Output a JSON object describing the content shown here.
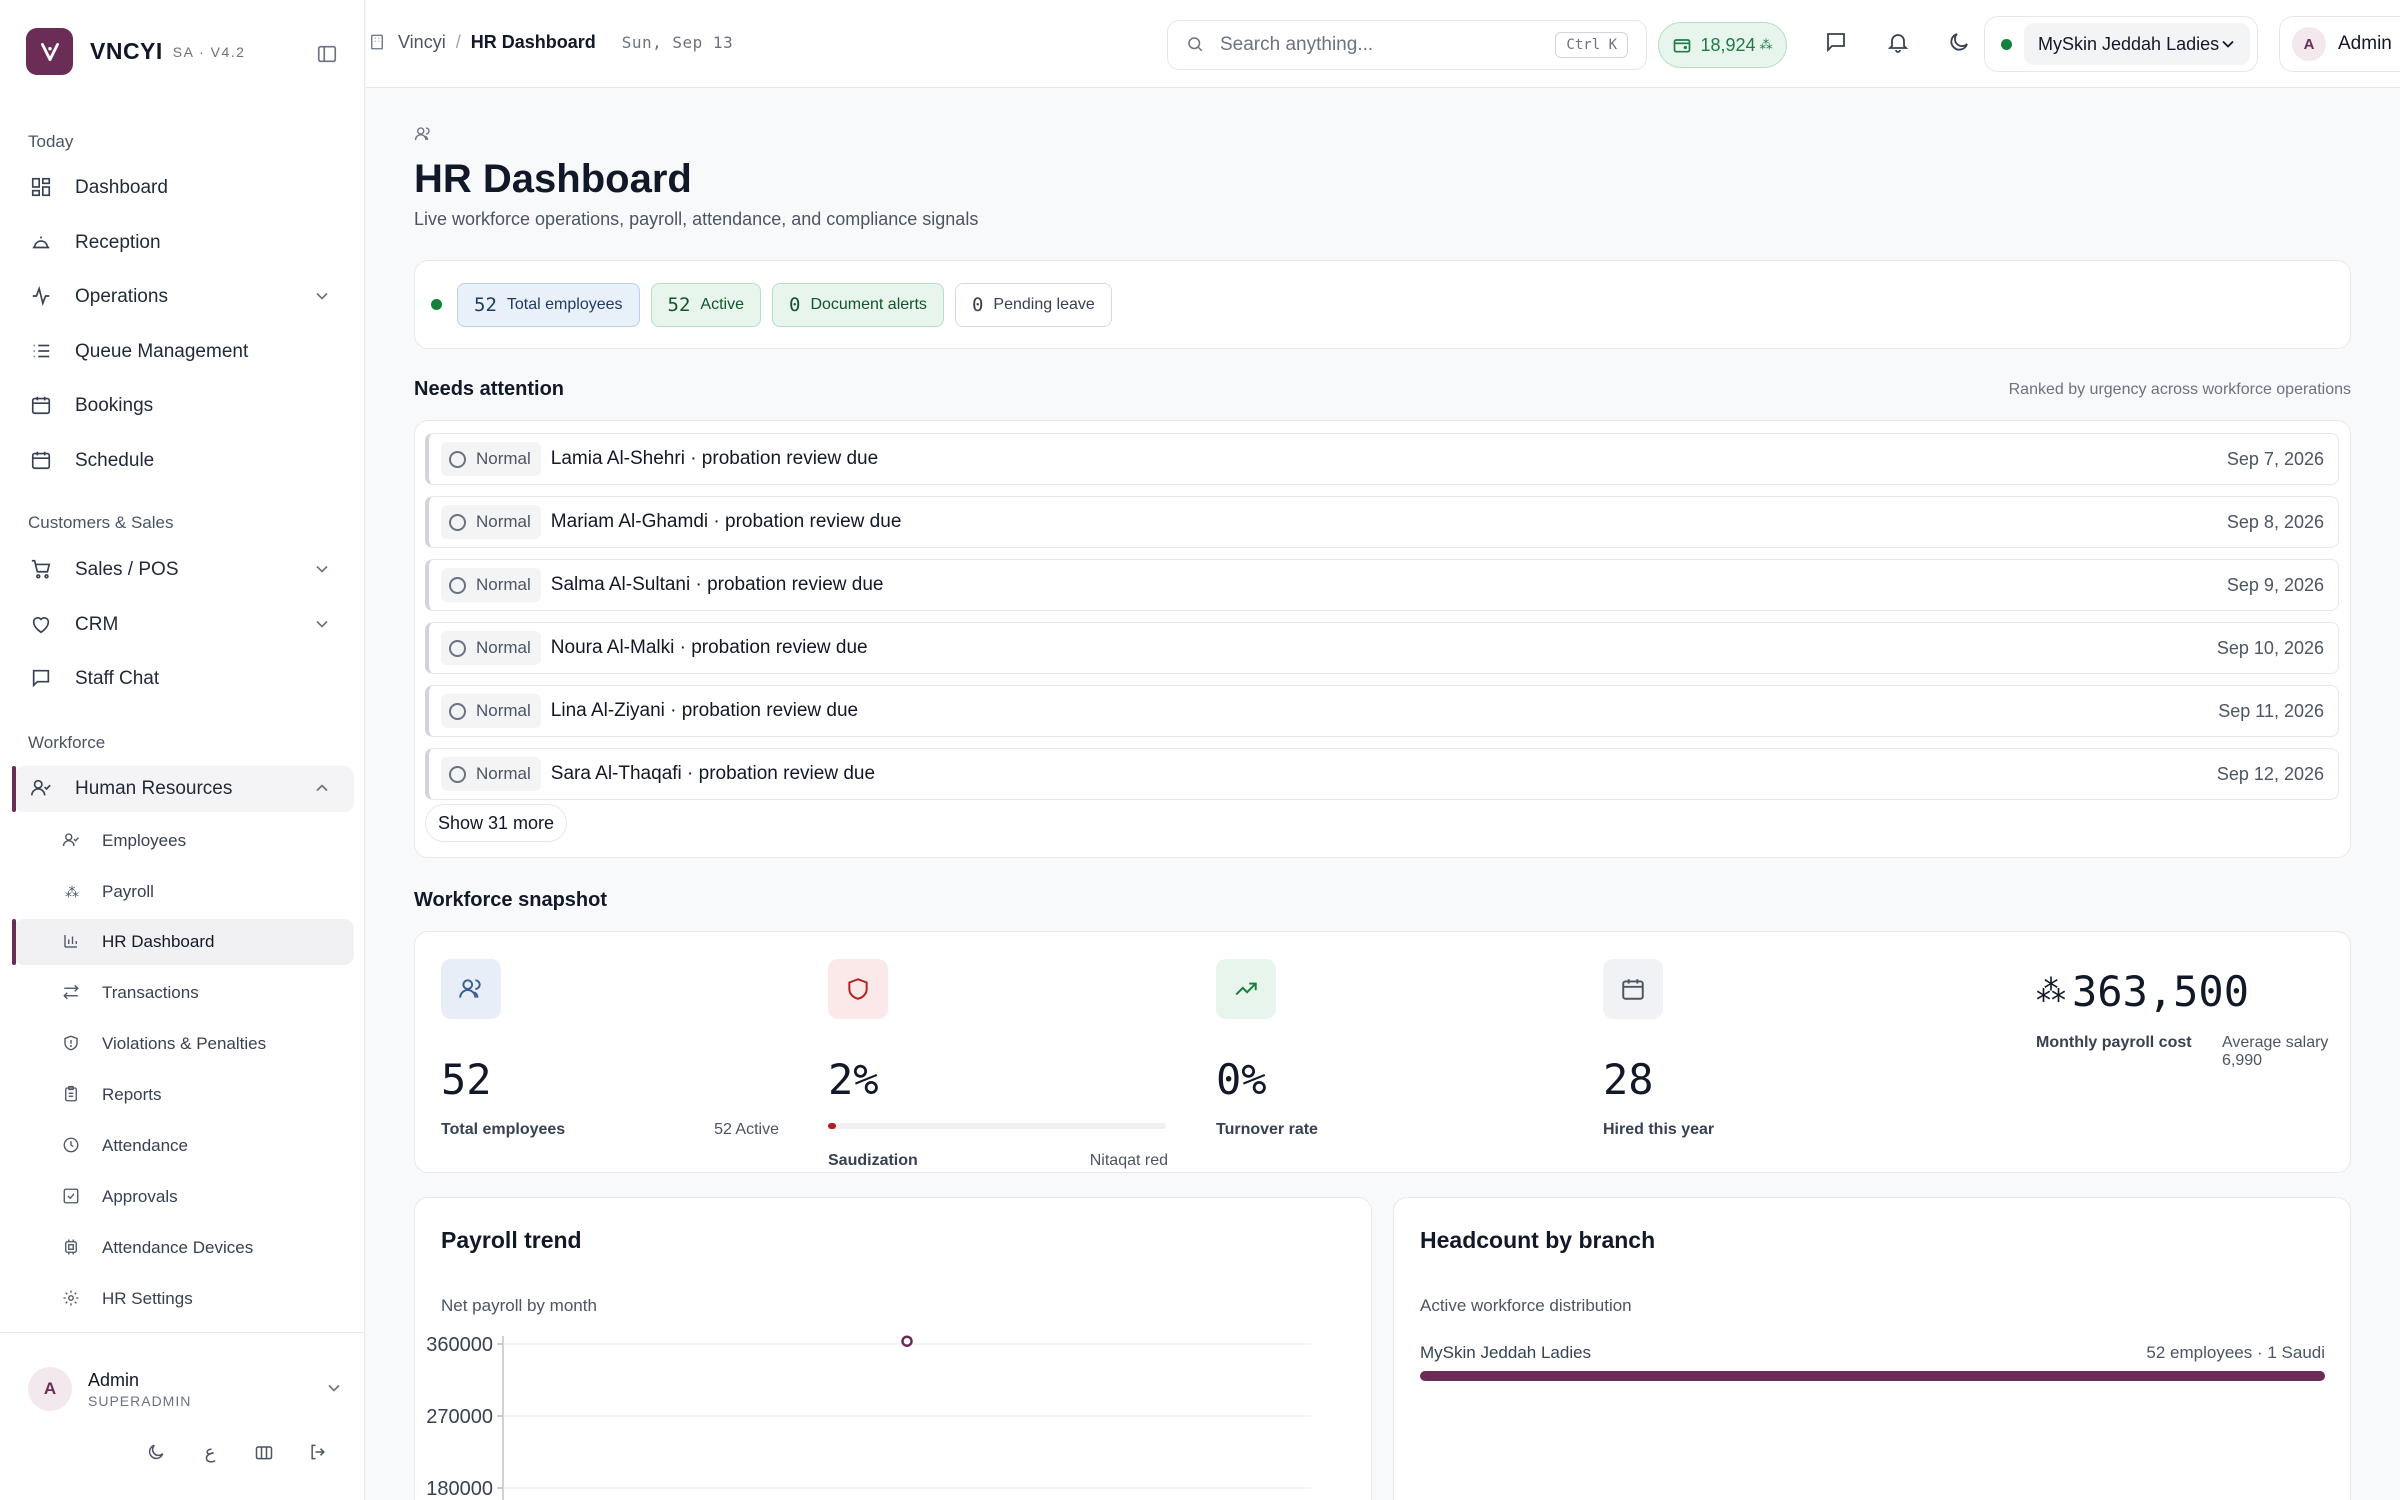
{
  "brand": {
    "name": "VNCYI",
    "version": "SA · V4.2"
  },
  "sidebar": {
    "sections": {
      "today": "Today",
      "customers": "Customers & Sales",
      "workforce": "Workforce"
    },
    "items": {
      "dashboard": "Dashboard",
      "reception": "Reception",
      "operations": "Operations",
      "queue": "Queue Management",
      "bookings": "Bookings",
      "schedule": "Schedule",
      "sales": "Sales / POS",
      "crm": "CRM",
      "chat": "Staff Chat",
      "hr": "Human Resources"
    },
    "hr_sub": {
      "employees": "Employees",
      "payroll": "Payroll",
      "hr_dashboard": "HR Dashboard",
      "transactions": "Transactions",
      "violations": "Violations & Penalties",
      "reports": "Reports",
      "attendance": "Attendance",
      "approvals": "Approvals",
      "devices": "Attendance Devices",
      "settings": "HR Settings"
    },
    "user": {
      "initial": "A",
      "name": "Admin",
      "role": "SUPERADMIN"
    }
  },
  "header": {
    "breadcrumb_root": "Vincyi",
    "breadcrumb_sep": "/",
    "breadcrumb_current": "HR Dashboard",
    "date": "Sun, Sep 13",
    "search_placeholder": "Search anything...",
    "search_shortcut": "Ctrl K",
    "balance": "18,924",
    "branch": "MySkin Jeddah Ladies",
    "user_initial": "A",
    "user_name": "Admin"
  },
  "page": {
    "title": "HR Dashboard",
    "subtitle": "Live workforce operations, payroll, attendance, and compliance signals"
  },
  "kpis": {
    "total": {
      "value": "52",
      "label": "Total employees"
    },
    "active": {
      "value": "52",
      "label": "Active"
    },
    "docs": {
      "value": "0",
      "label": "Document alerts"
    },
    "leave": {
      "value": "0",
      "label": "Pending leave"
    }
  },
  "attention": {
    "title": "Needs attention",
    "note": "Ranked by urgency across workforce operations",
    "rows": [
      {
        "priority": "Normal",
        "text": "Lamia Al-Shehri · probation review due",
        "date": "Sep 7, 2026"
      },
      {
        "priority": "Normal",
        "text": "Mariam Al-Ghamdi · probation review due",
        "date": "Sep 8, 2026"
      },
      {
        "priority": "Normal",
        "text": "Salma Al-Sultani · probation review due",
        "date": "Sep 9, 2026"
      },
      {
        "priority": "Normal",
        "text": "Noura Al-Malki · probation review due",
        "date": "Sep 10, 2026"
      },
      {
        "priority": "Normal",
        "text": "Lina Al-Ziyani · probation review due",
        "date": "Sep 11, 2026"
      },
      {
        "priority": "Normal",
        "text": "Sara Al-Thaqafi · probation review due",
        "date": "Sep 12, 2026"
      }
    ],
    "show_more": "Show 31 more"
  },
  "snapshot": {
    "title": "Workforce snapshot",
    "total": {
      "value": "52",
      "label": "Total employees",
      "aux": "52 Active"
    },
    "saudization": {
      "value": "2%",
      "label": "Saudization",
      "aux": "Nitaqat red",
      "progress": 0.02
    },
    "turnover": {
      "value": "0%",
      "label": "Turnover rate"
    },
    "hired": {
      "value": "28",
      "label": "Hired this year"
    },
    "payroll": {
      "value": "363,500",
      "label": "Monthly payroll cost",
      "aux": "Average salary 6,990"
    }
  },
  "payroll_card": {
    "title": "Payroll trend",
    "subtitle": "Net payroll by month"
  },
  "headcount_card": {
    "title": "Headcount by branch",
    "subtitle": "Active workforce distribution",
    "branches": [
      {
        "name": "MySkin Jeddah Ladies",
        "count": "52 employees · 1 Saudi",
        "share": 1.0
      }
    ]
  },
  "chart_data": {
    "type": "line",
    "title": "Payroll trend",
    "subtitle": "Net payroll by month",
    "ylim": [
      180000,
      360000
    ],
    "yticks": [
      "360000",
      "270000",
      "180000"
    ],
    "series": [
      {
        "values": [
          363500
        ]
      }
    ],
    "grid": true
  },
  "colors": {
    "brand": "#6b2d55",
    "success": "#15803d",
    "danger": "#b91c1c"
  }
}
